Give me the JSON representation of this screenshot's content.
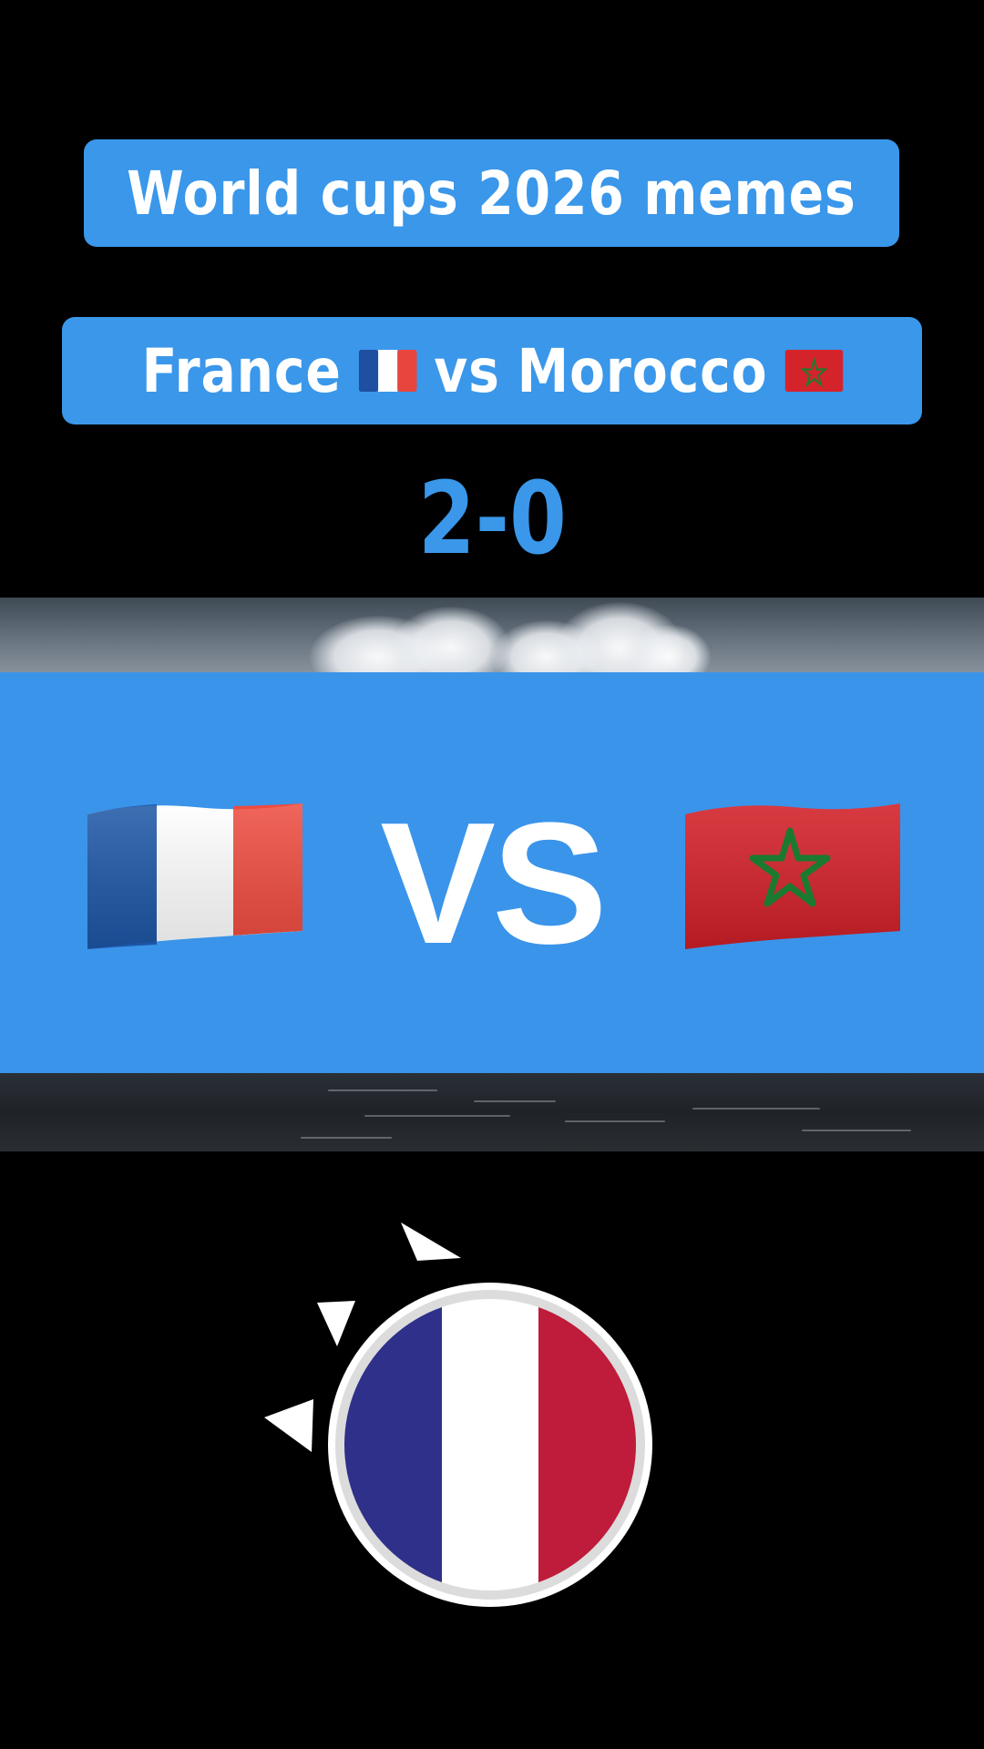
{
  "header": {
    "title": "World cups 2026 memes",
    "match_label_left": "France",
    "match_label_vs": "vs",
    "match_label_right": "Morocco",
    "score": "2-0"
  },
  "banner": {
    "vs_text": "VS",
    "left_flag": "france-flag-icon",
    "right_flag": "morocco-flag-icon"
  },
  "bottom": {
    "emblem": "france-flag-circle-icon"
  },
  "colors": {
    "accent": "#3a97ea",
    "background": "#000000",
    "france_blue": "#0055a4",
    "france_red": "#ef4135",
    "morocco_red": "#c1272d",
    "morocco_green": "#006233"
  }
}
